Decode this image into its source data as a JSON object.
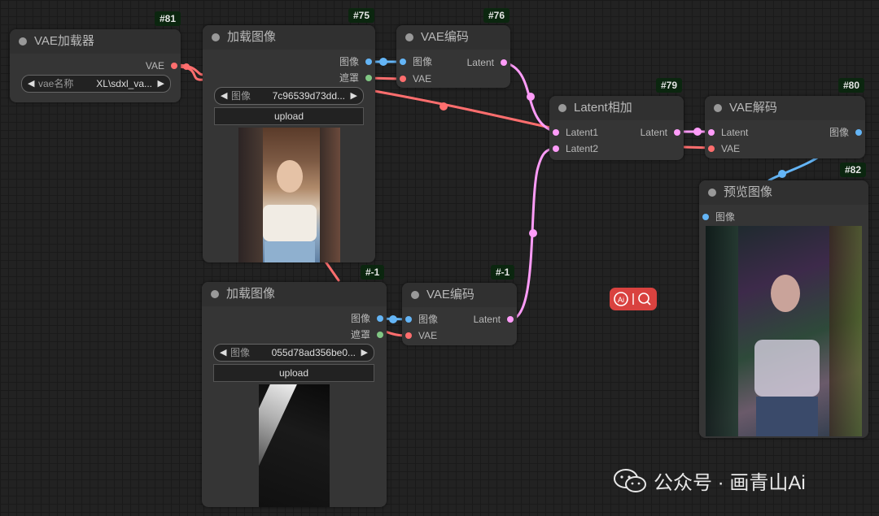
{
  "nodes": {
    "vae_loader": {
      "id": "#81",
      "title": "VAE加载器",
      "output": "VAE",
      "widget_label": "vae名称",
      "widget_value": "XL\\sdxl_va..."
    },
    "load_image_1": {
      "id": "#75",
      "title": "加载图像",
      "output_image": "图像",
      "output_mask": "遮罩",
      "widget_label": "图像",
      "widget_value": "7c96539d73dd...",
      "upload": "upload"
    },
    "vae_encode_1": {
      "id": "#76",
      "title": "VAE编码",
      "input_image": "图像",
      "input_vae": "VAE",
      "output": "Latent"
    },
    "latent_add": {
      "id": "#79",
      "title": "Latent相加",
      "input1": "Latent1",
      "input2": "Latent2",
      "output": "Latent"
    },
    "vae_decode": {
      "id": "#80",
      "title": "VAE解码",
      "input_latent": "Latent",
      "input_vae": "VAE",
      "output": "图像"
    },
    "preview": {
      "id": "#82",
      "title": "预览图像",
      "input": "图像"
    },
    "load_image_2": {
      "id": "#-1",
      "title": "加载图像",
      "output_image": "图像",
      "output_mask": "遮罩",
      "widget_label": "图像",
      "widget_value": "055d78ad356be0...",
      "upload": "upload"
    },
    "vae_encode_2": {
      "id": "#-1",
      "title": "VAE编码",
      "input_image": "图像",
      "input_vae": "VAE",
      "output": "Latent"
    }
  },
  "watermark": "公众号 · 画青山Ai",
  "colors": {
    "image": "#64b5f6",
    "mask": "#81c784",
    "vae": "#ff6e6e",
    "latent": "#ff9cf9",
    "badge_bg": "#0b260f"
  },
  "icons": [
    "left-arrow-icon",
    "right-arrow-icon",
    "ai-search-icon",
    "wechat-icon"
  ]
}
